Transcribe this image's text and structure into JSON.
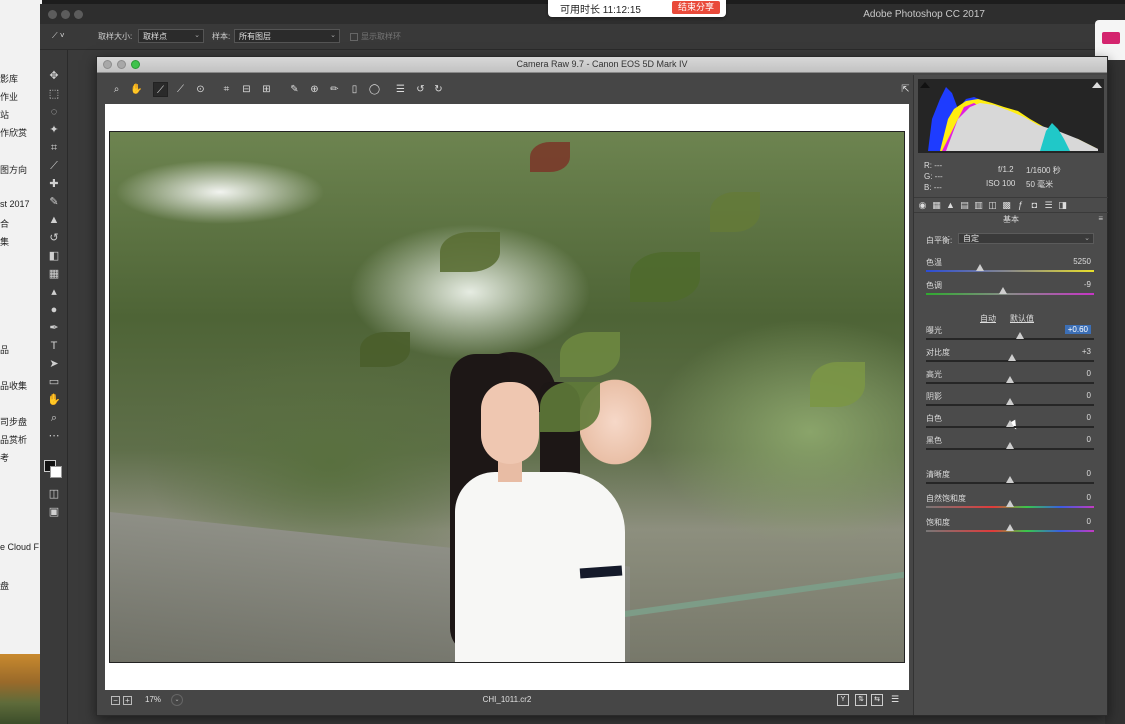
{
  "desktop_left": {
    "items": [
      "影库",
      "作业",
      "站",
      "作欣赏",
      "图方向",
      "st 2017",
      "合",
      "集",
      "品",
      "品收集",
      "司步盘",
      "品赏析",
      "考",
      "e Cloud F",
      "盘"
    ]
  },
  "recording": {
    "time": "可用时长 11:12:15",
    "stop": "结束分享"
  },
  "photoshop": {
    "app_title": "Adobe Photoshop CC 2017",
    "options": {
      "sample_size_label": "取样大小:",
      "sample_size_value": "取样点",
      "sample_label": "样本:",
      "sample_value": "所有图层",
      "show_ring": "显示取样环"
    }
  },
  "camera_raw": {
    "title": "Camera Raw 9.7 -  Canon EOS 5D Mark IV",
    "status": {
      "zoom": "17%",
      "filename": "CHI_1011.cr2"
    },
    "info": {
      "r": "R:  ---",
      "g": "G:  ---",
      "b": "B:  ---",
      "aperture": "f/1.2",
      "shutter": "1/1600 秒",
      "iso": "ISO 100",
      "focal": "50 毫米"
    },
    "section": "基本",
    "white_balance": {
      "label": "白平衡:",
      "value": "自定"
    },
    "auto": "自动",
    "default": "默认值",
    "sliders": [
      {
        "label": "色温",
        "value": "5250",
        "level": 0.32,
        "track": "temp"
      },
      {
        "label": "色调",
        "value": "-9",
        "level": 0.46,
        "track": "tint"
      },
      {
        "label": "曝光",
        "value": "+0.60",
        "level": 0.56,
        "track": "plain",
        "highlight": true
      },
      {
        "label": "对比度",
        "value": "+3",
        "level": 0.51,
        "track": "plain"
      },
      {
        "label": "高光",
        "value": "0",
        "level": 0.5,
        "track": "plain"
      },
      {
        "label": "阴影",
        "value": "0",
        "level": 0.5,
        "track": "plain"
      },
      {
        "label": "白色",
        "value": "0",
        "level": 0.5,
        "track": "plain"
      },
      {
        "label": "黑色",
        "value": "0",
        "level": 0.5,
        "track": "plain"
      },
      {
        "label": "清晰度",
        "value": "0",
        "level": 0.5,
        "track": "plain"
      },
      {
        "label": "自然饱和度",
        "value": "0",
        "level": 0.5,
        "track": "sat"
      },
      {
        "label": "饱和度",
        "value": "0",
        "level": 0.5,
        "track": "sat"
      }
    ]
  }
}
